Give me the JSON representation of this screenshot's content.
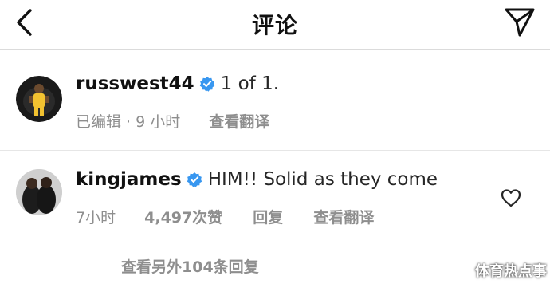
{
  "header": {
    "title": "评论",
    "back_icon": "chevron-left-icon",
    "send_icon": "paper-plane-icon"
  },
  "comments": [
    {
      "username": "russwest44",
      "text": "1 of 1.",
      "meta": "已编辑 · 9 小时",
      "translate": "查看翻译"
    },
    {
      "username": "kingjames",
      "text": "HIM!! Solid as they come",
      "time": "7小时",
      "likes": "4,497次赞",
      "reply": "回复",
      "translate": "查看翻译"
    }
  ],
  "more_replies": "查看另外104条回复",
  "watermark": "体育热点事",
  "colors": {
    "verified": "#3897f0",
    "secondary_text": "#8e8e8e",
    "divider": "#dbdbdb"
  }
}
